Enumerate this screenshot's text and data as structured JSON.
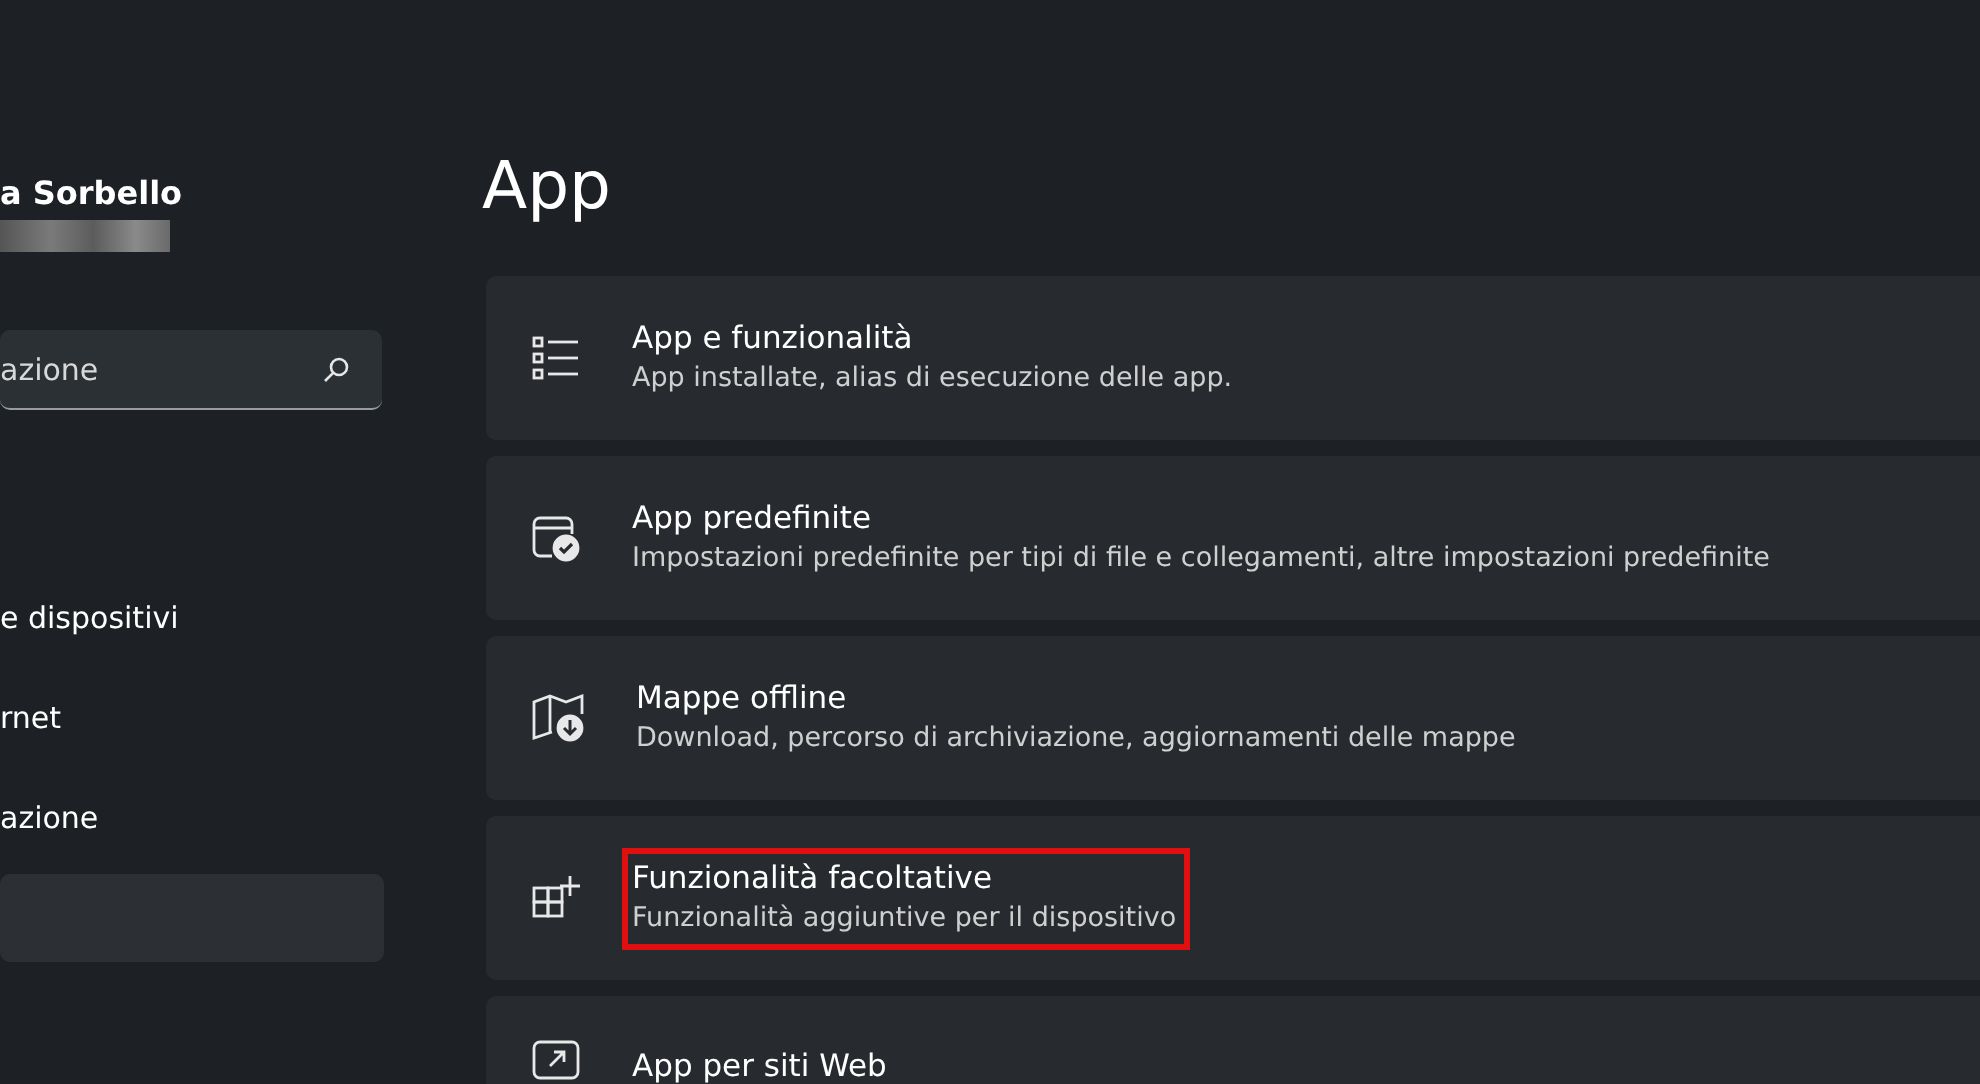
{
  "user": {
    "name": "a Sorbello"
  },
  "search": {
    "placeholder": "azione"
  },
  "sidebar": {
    "items": [
      {
        "label": "e dispositivi",
        "selected": false
      },
      {
        "label": "rnet",
        "selected": false
      },
      {
        "label": "azione",
        "selected": false
      },
      {
        "selected": true
      }
    ]
  },
  "page_title": "App",
  "cards": [
    {
      "kind": "list",
      "title": "App e funzionalità",
      "description": "App installate, alias di esecuzione delle app.",
      "highlighted": false
    },
    {
      "kind": "default-apps",
      "title": "App predefinite",
      "description": "Impostazioni predefinite per tipi di file e collegamenti, altre impostazioni predefinite",
      "highlighted": false
    },
    {
      "kind": "map",
      "title": "Mappe offline",
      "description": "Download, percorso di archiviazione, aggiornamenti delle mappe",
      "highlighted": false
    },
    {
      "kind": "grid-plus",
      "title": "Funzionalità facoltative",
      "description": "Funzionalità aggiuntive per il dispositivo",
      "highlighted": true
    },
    {
      "kind": "web",
      "title": "App per siti Web",
      "highlighted": false
    }
  ]
}
